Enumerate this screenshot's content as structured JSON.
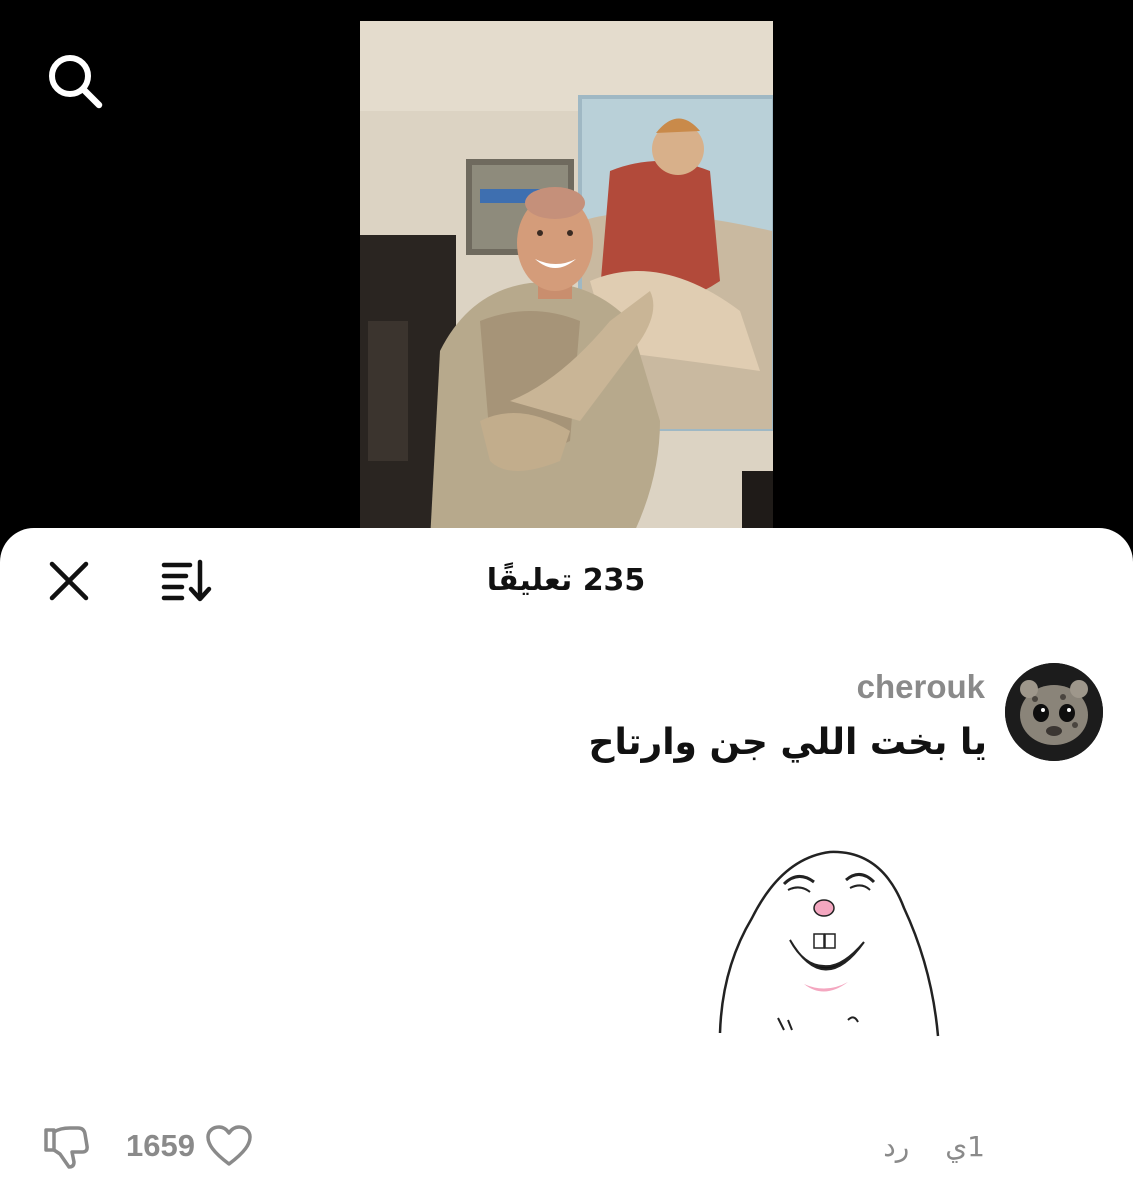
{
  "header": {
    "search_icon": "search-icon"
  },
  "sheet": {
    "title": "235 تعليقًا",
    "close_icon": "close-icon",
    "sort_icon": "sort-icon"
  },
  "comment": {
    "username": "cherouk",
    "text": "يا بخت اللي جن وارتاح",
    "time": "1ي",
    "reply_label": "رد",
    "likes": "1659",
    "like_icon": "heart-icon",
    "dislike_icon": "thumbs-down-icon",
    "sticker": "laughing-rabbit-sticker"
  },
  "colors": {
    "sheet_bg": "#ffffff",
    "muted_text": "#8a8a8a",
    "primary_text": "#111111",
    "background": "#000000"
  }
}
